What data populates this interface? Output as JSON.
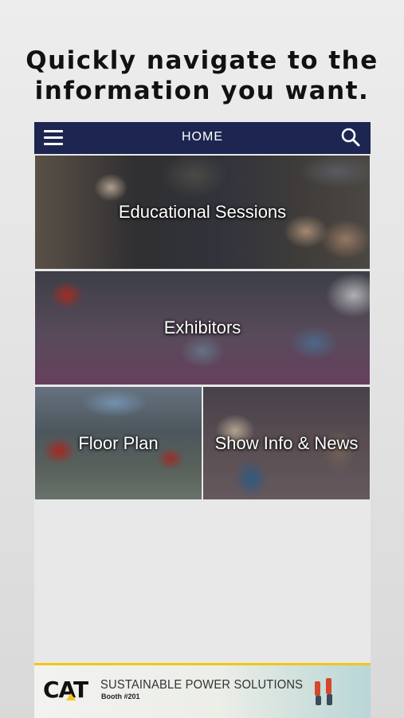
{
  "headline": {
    "line1": "Quickly navigate to the",
    "line2": "information you want."
  },
  "topbar": {
    "title": "HOME",
    "menu_icon": "hamburger-menu-icon",
    "search_icon": "search-icon",
    "background": "#1c2651"
  },
  "tiles": [
    {
      "label": "Educational Sessions"
    },
    {
      "label": "Exhibitors"
    },
    {
      "label": "Floor Plan"
    },
    {
      "label": "Show Info & News"
    }
  ],
  "banner": {
    "logo": "CAT",
    "title": "SUSTAINABLE POWER SOLUTIONS",
    "booth": "Booth #201",
    "accent": "#f2c618"
  }
}
